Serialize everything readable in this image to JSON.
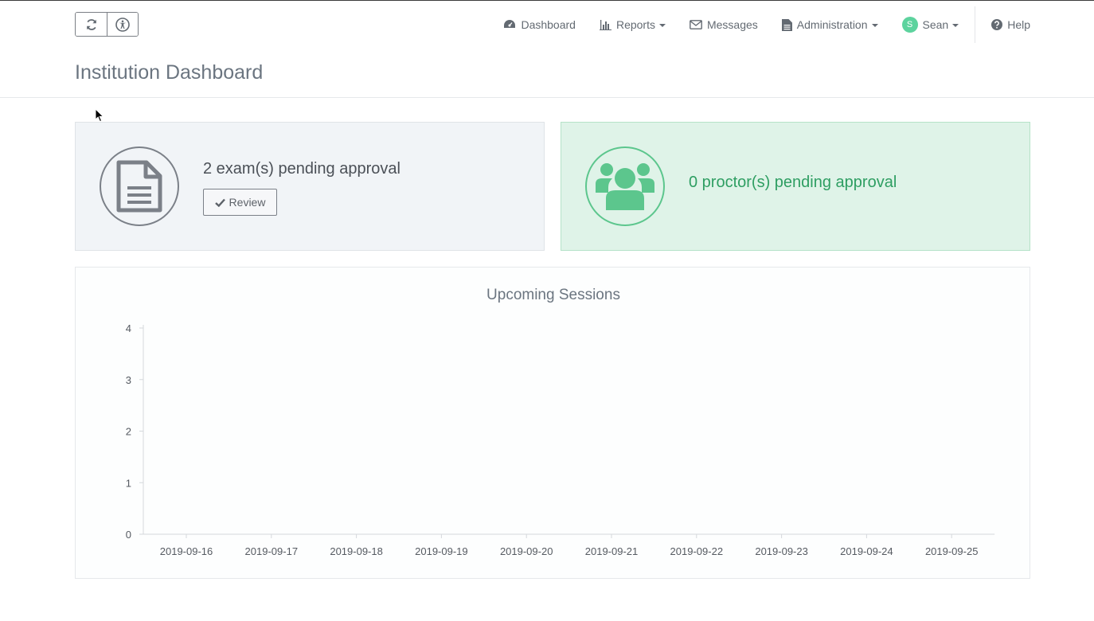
{
  "header": {
    "nav": {
      "dashboard": "Dashboard",
      "reports": "Reports",
      "messages": "Messages",
      "administration": "Administration",
      "user_initial": "S",
      "user_name": "Sean",
      "help": "Help"
    },
    "toolbar_icons": [
      "refresh-icon",
      "accessibility-icon"
    ]
  },
  "page": {
    "title": "Institution Dashboard"
  },
  "cards": {
    "exams": {
      "text": "2 exam(s) pending approval",
      "button_label": "Review",
      "icon": "document-icon"
    },
    "proctors": {
      "text": "0 proctor(s) pending approval",
      "icon": "users-icon"
    }
  },
  "colors": {
    "accent_green": "#5dd39e",
    "proctor_text": "#2e9e62",
    "exam_card_bg": "#f1f4f7",
    "proctor_card_bg": "#dff3e8"
  },
  "chart_data": {
    "type": "line",
    "title": "Upcoming Sessions",
    "x": [
      "2019-09-16",
      "2019-09-17",
      "2019-09-18",
      "2019-09-19",
      "2019-09-20",
      "2019-09-21",
      "2019-09-22",
      "2019-09-23",
      "2019-09-24",
      "2019-09-25"
    ],
    "yticks": [
      0,
      1,
      2,
      3,
      4
    ],
    "ylim": [
      0,
      4
    ],
    "series": [],
    "grid": false
  }
}
